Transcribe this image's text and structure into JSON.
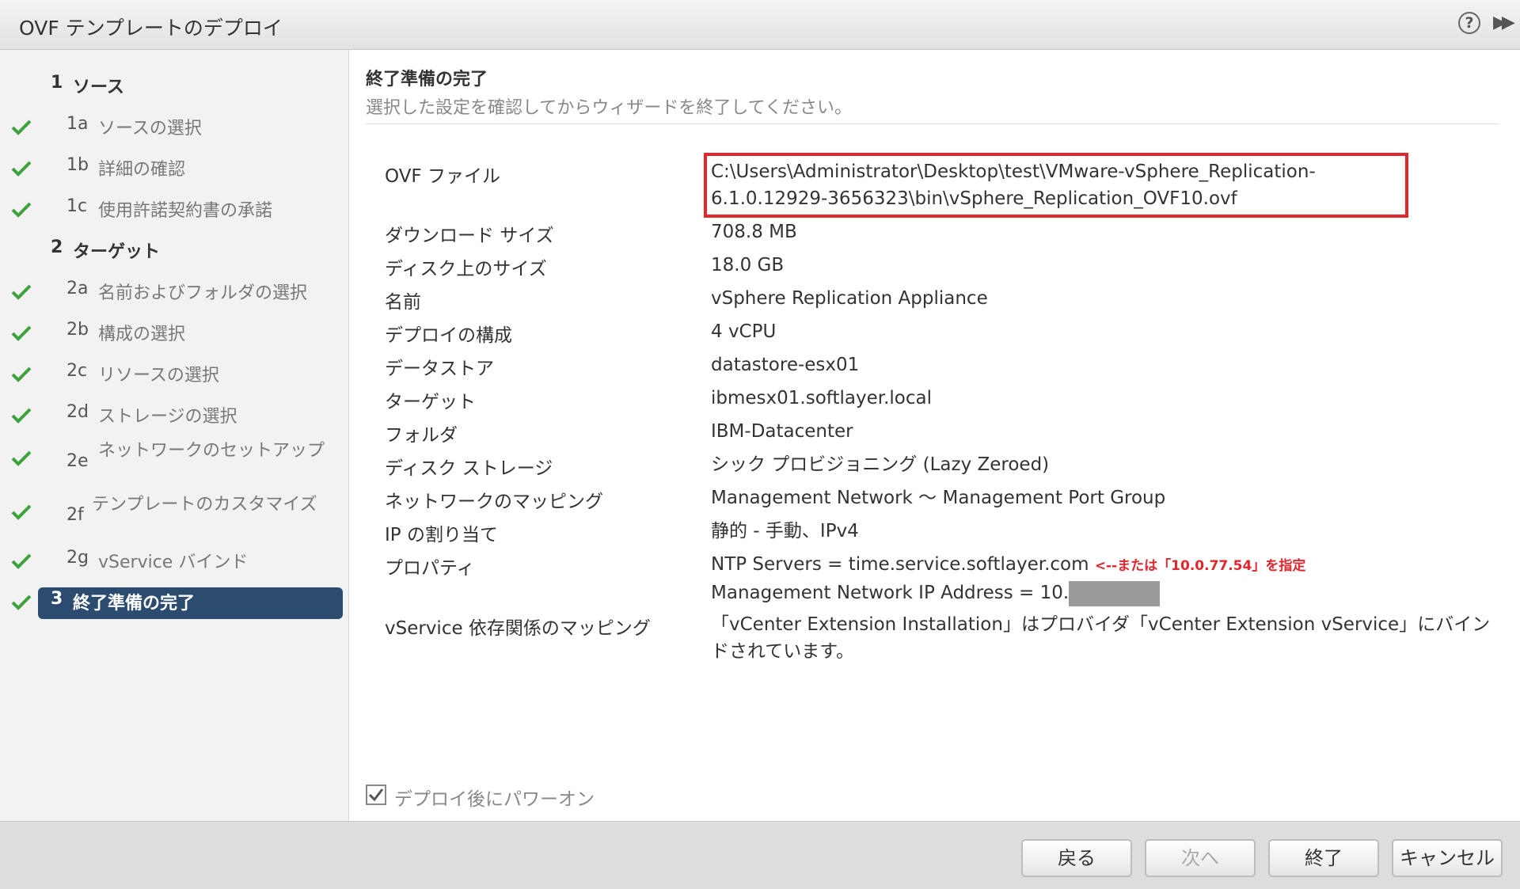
{
  "window": {
    "title": "OVF テンプレートのデプロイ",
    "help_icon": "?",
    "collapse_icon": "▶▶"
  },
  "sidebar": {
    "items": [
      {
        "num": "1",
        "label": "ソース",
        "group": true,
        "checked": false
      },
      {
        "num": "1a",
        "label": "ソースの選択",
        "group": false,
        "checked": true
      },
      {
        "num": "1b",
        "label": "詳細の確認",
        "group": false,
        "checked": true
      },
      {
        "num": "1c",
        "label": "使用許諾契約書の承諾",
        "group": false,
        "checked": true
      },
      {
        "num": "2",
        "label": "ターゲット",
        "group": true,
        "checked": false
      },
      {
        "num": "2a",
        "label": "名前およびフォルダの選択",
        "group": false,
        "checked": true
      },
      {
        "num": "2b",
        "label": "構成の選択",
        "group": false,
        "checked": true
      },
      {
        "num": "2c",
        "label": "リソースの選択",
        "group": false,
        "checked": true
      },
      {
        "num": "2d",
        "label": "ストレージの選択",
        "group": false,
        "checked": true
      },
      {
        "num": "2e",
        "label": "ネットワークのセットアップ",
        "group": false,
        "checked": true
      },
      {
        "num": "2f",
        "label": "テンプレートのカスタマイズ",
        "group": false,
        "checked": true
      },
      {
        "num": "2g",
        "label": "vService バインド",
        "group": false,
        "checked": true
      },
      {
        "num": "3",
        "label": "終了準備の完了",
        "group": true,
        "checked": true,
        "active": true
      }
    ]
  },
  "main": {
    "title": "終了準備の完了",
    "subtitle": "選択した設定を確認してからウィザードを終了してください。",
    "rows": [
      {
        "label": "OVF ファイル",
        "value": "C:\\Users\\Administrator\\Desktop\\test\\VMware-vSphere_Replication-6.1.0.12929-3656323\\bin\\vSphere_Replication_OVF10.ovf"
      },
      {
        "label": "ダウンロード サイズ",
        "value": "708.8 MB"
      },
      {
        "label": "ディスク上のサイズ",
        "value": "18.0 GB"
      },
      {
        "label": "名前",
        "value": "vSphere Replication Appliance"
      },
      {
        "label": "デプロイの構成",
        "value": "4 vCPU"
      },
      {
        "label": "データストア",
        "value": "datastore-esx01"
      },
      {
        "label": "ターゲット",
        "value": "ibmesx01.softlayer.local"
      },
      {
        "label": "フォルダ",
        "value": "IBM-Datacenter"
      },
      {
        "label": "ディスク ストレージ",
        "value": "シック プロビジョニング (Lazy Zeroed)"
      },
      {
        "label": "ネットワークのマッピング",
        "value": "Management Network ～ Management Port Group"
      },
      {
        "label": "IP の割り当て",
        "value": "静的 - 手動、IPv4"
      },
      {
        "label": "プロパティ",
        "value_line1": "NTP Servers = time.service.softlayer.com",
        "note": "<--または「10.0.77.54」を指定",
        "value_line2": "Management Network IP Address = 10."
      },
      {
        "label": "vService 依存関係のマッピング",
        "value": "「vCenter Extension Installation」はプロバイダ「vCenter Extension vService」にバインドされています。"
      }
    ],
    "power_on": {
      "label": "デプロイ後にパワーオン",
      "checked": true
    }
  },
  "footer": {
    "back": "戻る",
    "next": "次へ",
    "finish": "終了",
    "cancel": "キャンセル"
  },
  "colors": {
    "accent": "#2c4c6f",
    "check": "#3aa33a",
    "highlight": "#e3262b"
  }
}
